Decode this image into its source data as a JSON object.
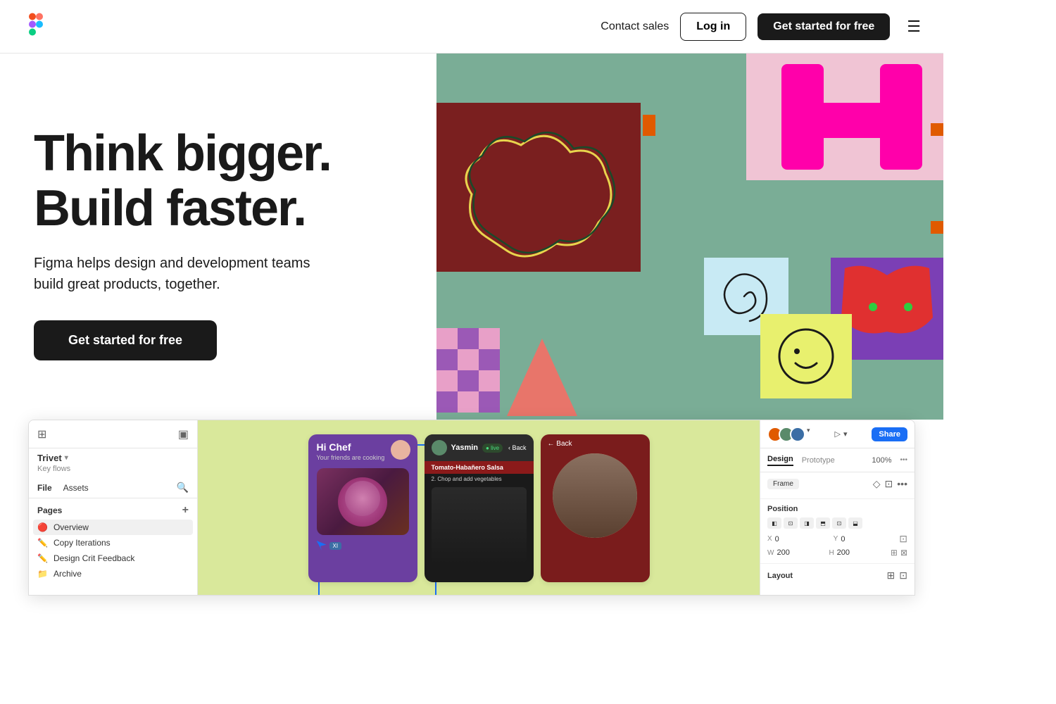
{
  "nav": {
    "logo_alt": "Figma logo",
    "contact_sales": "Contact sales",
    "login_label": "Log in",
    "cta_label": "Get started for free",
    "menu_label": "Menu"
  },
  "hero": {
    "title_line1": "Think bigger.",
    "title_line2": "Build faster.",
    "subtitle": "Figma helps design and development teams build great products, together.",
    "cta_label": "Get started for free"
  },
  "figma_ui": {
    "brand": "Trivet",
    "key_flows": "Key flows",
    "file_tab": "File",
    "assets_tab": "Assets",
    "pages_label": "Pages",
    "pages": [
      {
        "label": "Overview",
        "icon": "🔴",
        "active": true
      },
      {
        "label": "Copy Iterations",
        "icon": "✏️",
        "active": false
      },
      {
        "label": "Design Crit Feedback",
        "icon": "🖊️",
        "active": false
      },
      {
        "label": "Archive",
        "icon": "📁",
        "active": false
      }
    ],
    "right_panel": {
      "tabs": [
        "Design",
        "Prototype"
      ],
      "active_tab": "Design",
      "zoom": "100%",
      "frame_label": "Frame",
      "position_label": "Position",
      "x_val": "0",
      "y_val": "0",
      "w_val": "200",
      "h_val": "200",
      "layout_label": "Layout",
      "share_label": "Share"
    },
    "canvas": {
      "frame1_title": "Hi Chef",
      "frame1_sub": "Your friends are cooking",
      "frame2_name": "Yasmin",
      "frame2_recipe": "Tomato-Habañero Salsa",
      "frame2_step": "2. Chop and add vegetables",
      "frame3_back": "← Back"
    }
  }
}
